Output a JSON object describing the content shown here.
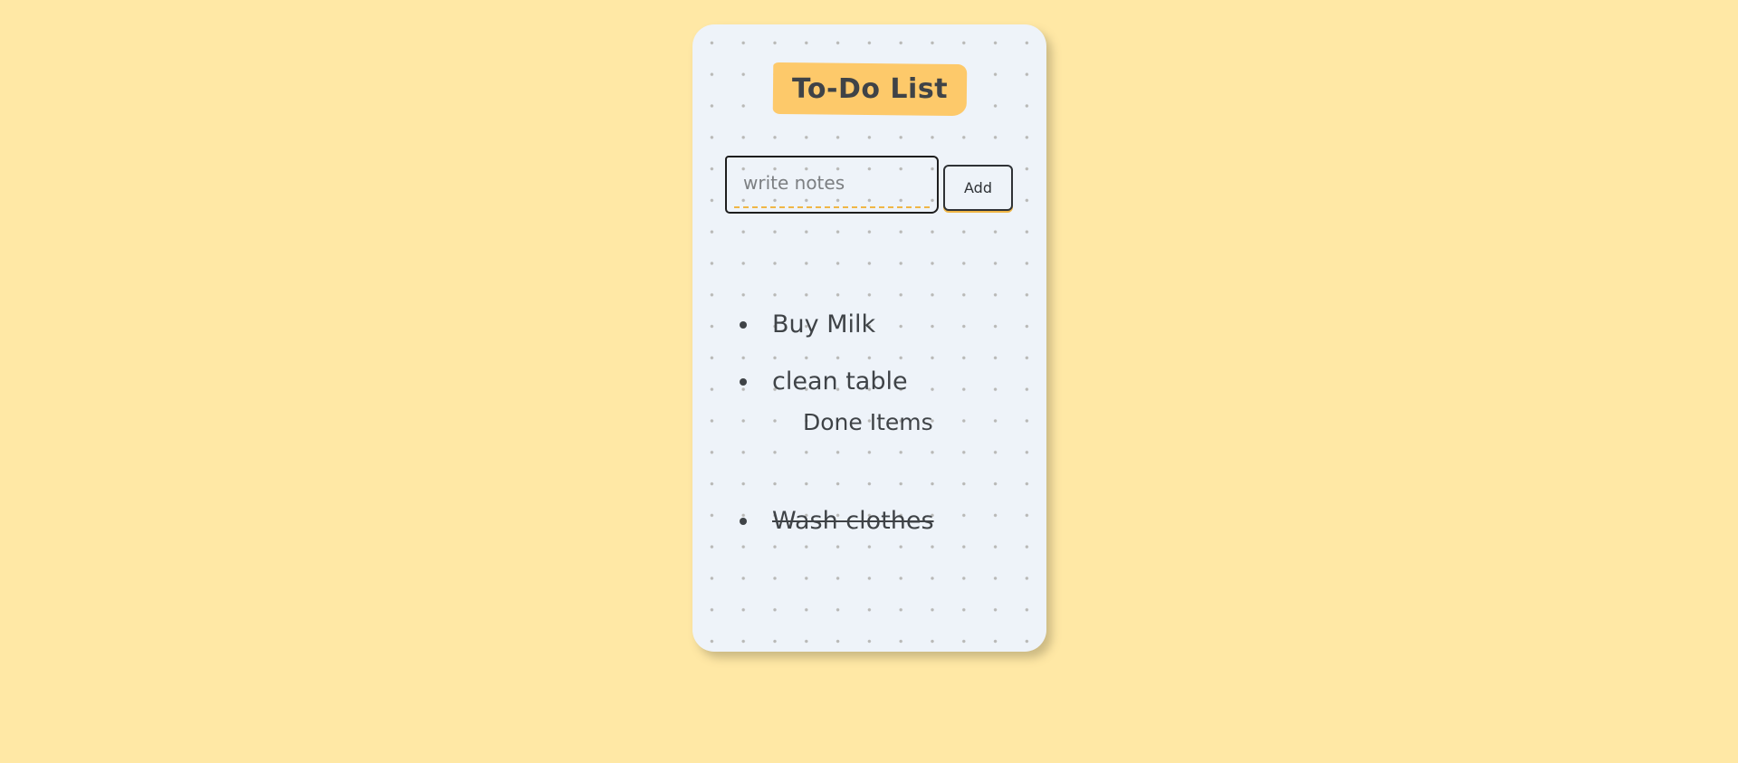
{
  "app": {
    "title": "To-Do List"
  },
  "input": {
    "placeholder": "write notes",
    "value": ""
  },
  "add_button": {
    "label": "Add"
  },
  "todo_items": [
    {
      "text": "Buy Milk"
    },
    {
      "text": "clean table"
    }
  ],
  "done_section": {
    "heading": "Done Items",
    "items": [
      {
        "text": "Wash clothes"
      }
    ]
  },
  "colors": {
    "background": "#ffe8a5",
    "card": "#eef3f9",
    "title_highlight": "#fdc96a",
    "text": "#3f4347",
    "accent_dash": "#f0b646"
  }
}
